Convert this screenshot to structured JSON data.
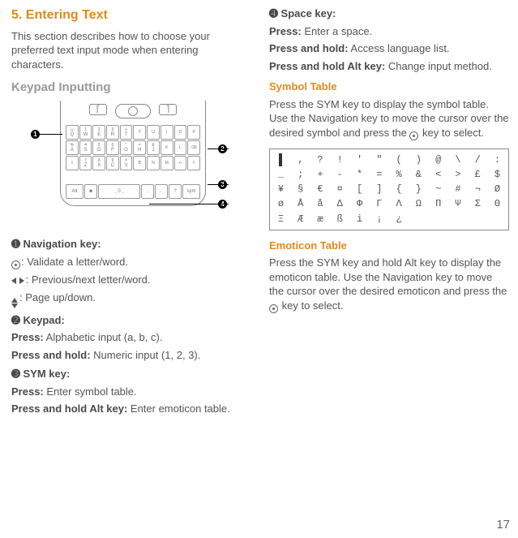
{
  "left": {
    "title": "5. Entering Text",
    "intro": "This section describes how to choose your preferred text input mode when entering characters.",
    "sub": "Keypad Inputting",
    "nav_heading_num": "➊",
    "nav_heading": " Navigation key:",
    "nav_l1_tail": ": Validate a letter/word.",
    "nav_l2_tail": ": Previous/next letter/word.",
    "nav_l3_tail": ": Page up/down.",
    "kp_heading_num": "➋",
    "kp_heading": " Keypad:",
    "kp_l1_b": "Press:",
    "kp_l1_t": " Alphabetic input (a, b, c).",
    "kp_l2_b": "Press and hold:",
    "kp_l2_t": " Numeric input (1, 2, 3).",
    "sym_heading_num": "➌",
    "sym_heading": " SYM key:",
    "sym_l1_b": "Press:",
    "sym_l1_t": " Enter symbol table.",
    "sym_l2_b": "Press and hold Alt key:",
    "sym_l2_t": " Enter emoticon table."
  },
  "right": {
    "sp_heading_num": "➍",
    "sp_heading": " Space key:",
    "sp_l1_b": "Press:",
    "sp_l1_t": " Enter a space.",
    "sp_l2_b": "Press and hold:",
    "sp_l2_t": " Access language list.",
    "sp_l3_b": "Press and hold Alt key:",
    "sp_l3_t": " Change input method.",
    "st_heading": "Symbol Table",
    "st_para_a": "Press the SYM key to display the symbol table. Use the Navigation key to move the cursor over the desired symbol and press the ",
    "st_para_b": " key to select.",
    "et_heading": "Emoticon Table",
    "et_para_a": "Press the SYM key and hold Alt key to display the emoticon table. Use the Navigation key to move the cursor over the desired emoticon and press the ",
    "et_para_b": " key to select."
  },
  "symbol_rows": [
    [
      ".",
      ",",
      "?",
      "!",
      "'",
      "\"",
      "(",
      ")",
      "@",
      "\\",
      "/",
      ":"
    ],
    [
      "_",
      ";",
      "+",
      "-",
      "*",
      "=",
      "%",
      "&",
      "<",
      ">",
      "£",
      "$"
    ],
    [
      "¥",
      "§",
      "€",
      "¤",
      "[",
      "]",
      "{",
      "}",
      "~",
      "#",
      "¬",
      "Ø"
    ],
    [
      "ø",
      "Å",
      "å",
      "Δ",
      "Φ",
      "Γ",
      "Λ",
      "Ω",
      "Π",
      "Ψ",
      "Σ",
      "Θ"
    ],
    [
      "Ξ",
      "Æ",
      "æ",
      "ß",
      "i",
      "¡",
      "¿",
      "",
      "",
      "",
      "",
      ""
    ]
  ],
  "symbol_selected": ".",
  "page_num": "17",
  "keys_r1": [
    [
      "☺",
      "Q"
    ],
    [
      "1",
      "W"
    ],
    [
      "2",
      "E"
    ],
    [
      "3",
      "R"
    ],
    [
      "+",
      "T"
    ],
    [
      "Y",
      ""
    ],
    [
      "U",
      ""
    ],
    [
      "I",
      ""
    ],
    [
      "O",
      ""
    ],
    [
      "P",
      ""
    ]
  ],
  "keys_r2": [
    [
      "%",
      "A"
    ],
    [
      "4",
      "S"
    ],
    [
      "5",
      "D"
    ],
    [
      "6",
      "F"
    ],
    [
      "*",
      "G"
    ],
    [
      "=",
      "H"
    ],
    [
      "&",
      "J"
    ],
    [
      "K",
      ""
    ],
    [
      "L",
      ""
    ],
    [
      "⌫",
      ""
    ]
  ],
  "keys_r3": [
    [
      "⇧",
      ""
    ],
    [
      "7",
      "Z"
    ],
    [
      "8",
      "X"
    ],
    [
      "9",
      "C"
    ],
    [
      "#",
      "V"
    ],
    [
      "B",
      ""
    ],
    [
      "N",
      ""
    ],
    [
      "M",
      ""
    ],
    [
      "↩",
      ""
    ],
    [
      "⇧",
      ""
    ]
  ],
  "bottom_keys": {
    "alt": "Alt",
    "emoji": "☻",
    "space": "ˍ    0    ˍ",
    "comma": ",",
    "dot": ".",
    "q": "?",
    "sym": "sym"
  }
}
